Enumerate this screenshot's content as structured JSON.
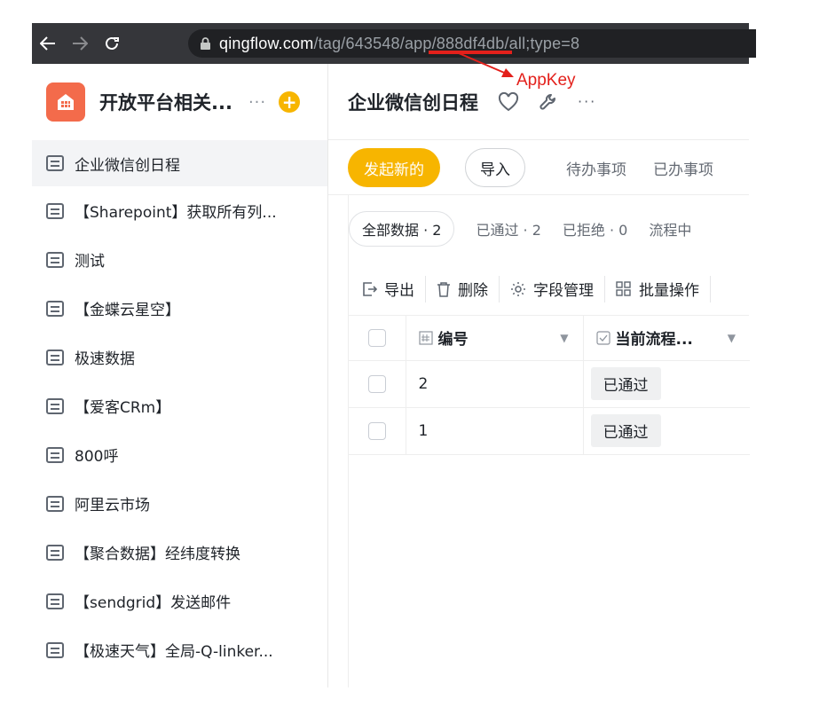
{
  "browser": {
    "url_host": "qingflow.com",
    "url_path": "/tag/643548/app/888df4db/all;type=8"
  },
  "annotation": {
    "label": "AppKey",
    "color": "#e3201b"
  },
  "sidebar": {
    "title": "开放平台相关...",
    "more": "···",
    "add": "+",
    "items": [
      {
        "label": "企业微信创日程"
      },
      {
        "label": "【Sharepoint】获取所有列..."
      },
      {
        "label": "测试"
      },
      {
        "label": "【金蝶云星空】"
      },
      {
        "label": "极速数据"
      },
      {
        "label": "【爱客CRm】"
      },
      {
        "label": "800呼"
      },
      {
        "label": "阿里云市场"
      },
      {
        "label": "【聚合数据】经纬度转换"
      },
      {
        "label": "【sendgrid】发送邮件"
      },
      {
        "label": "【极速天气】全局-Q-linker..."
      }
    ]
  },
  "main": {
    "title": "企业微信创日程",
    "more": "···",
    "actions": {
      "primary": "发起新的",
      "import": "导入",
      "todo": "待办事项",
      "done": "已办事项"
    },
    "filters": [
      {
        "label": "全部数据 · 2"
      },
      {
        "label": "已通过 · 2"
      },
      {
        "label": "已拒绝 · 0"
      },
      {
        "label": "流程中"
      }
    ],
    "toolbar": {
      "export": "导出",
      "delete": "删除",
      "fields": "字段管理",
      "batch": "批量操作"
    },
    "table": {
      "columns": [
        "编号",
        "当前流程..."
      ],
      "rows": [
        {
          "id": "2",
          "status": "已通过"
        },
        {
          "id": "1",
          "status": "已通过"
        }
      ]
    }
  },
  "colors": {
    "accent": "#f7b500",
    "logo": "#f36b4b"
  }
}
